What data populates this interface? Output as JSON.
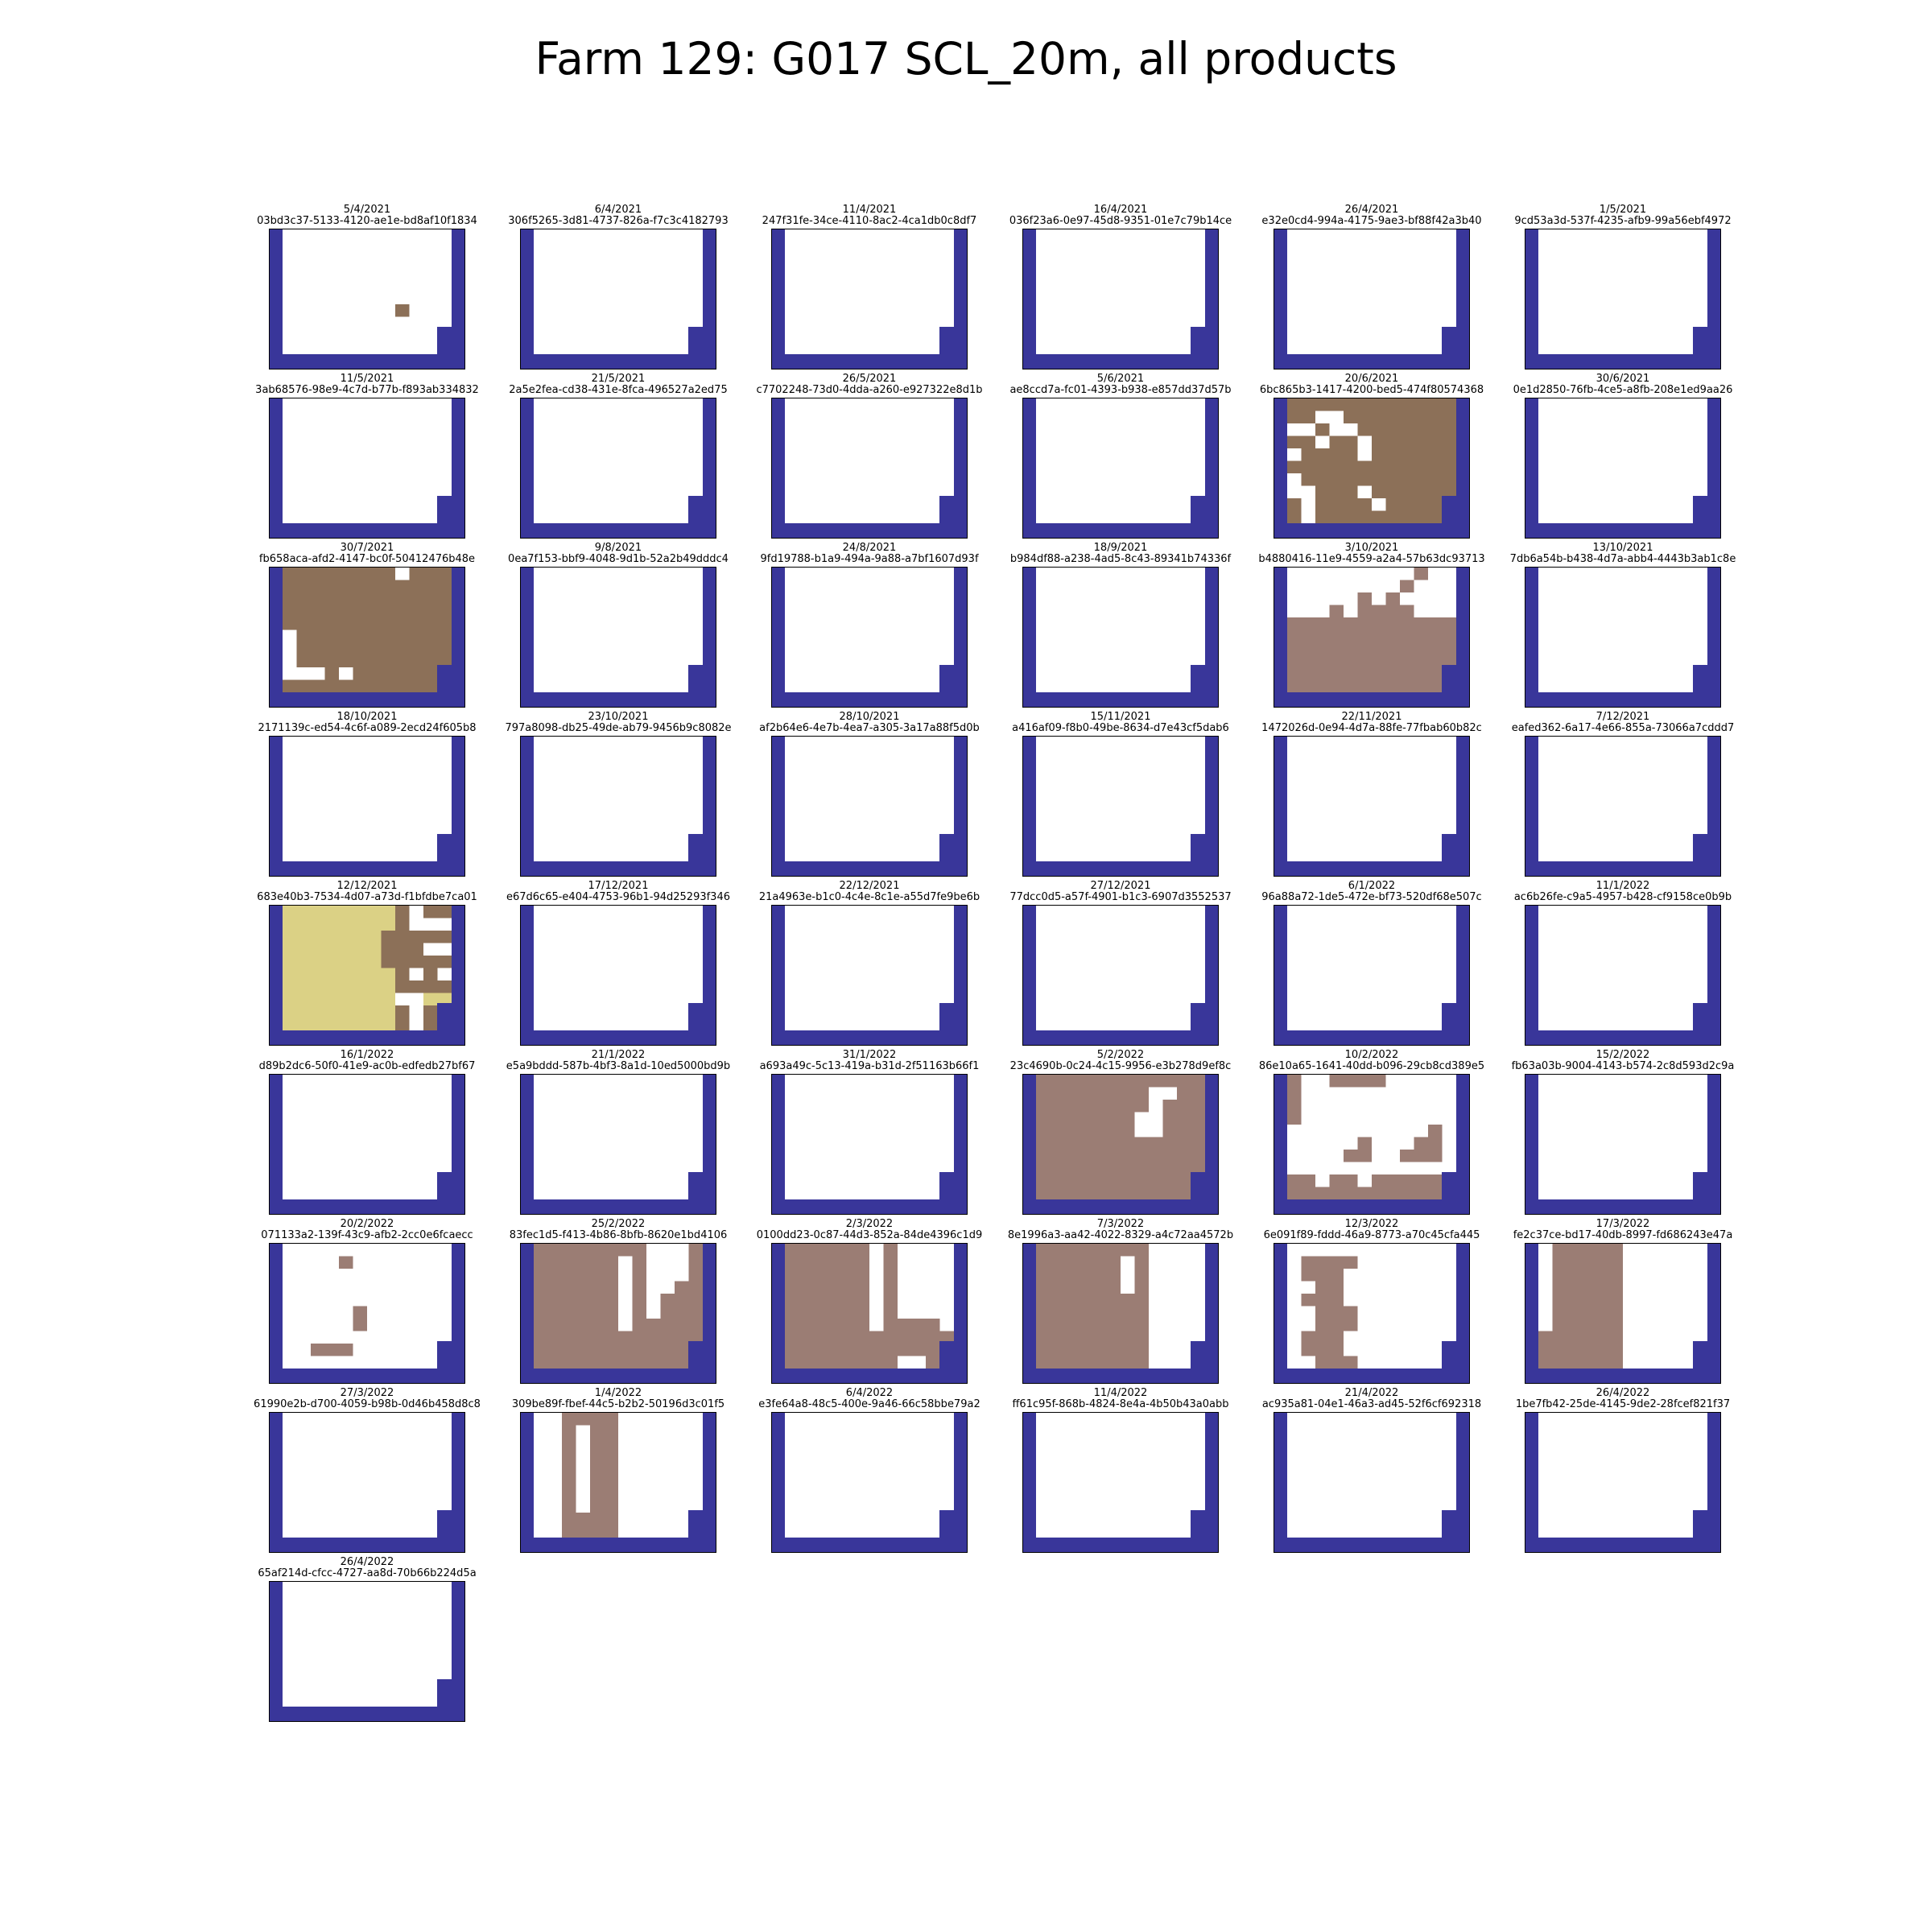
{
  "title": "Farm 129: G017 SCL_20m, all products",
  "colors": {
    "clear": "#ffffff",
    "nodata": "#39369a",
    "bare": "#8c7058",
    "cloud": "#9b7d74",
    "snow": "#dbd185"
  },
  "grid": {
    "cols": 13,
    "rows": 10
  },
  "panels": [
    {
      "date": "5/4/2021",
      "id": "03bd3c37-5133-4120-ae1e-bd8af10f1834",
      "cells": [
        {
          "c": "bare",
          "r": [
            [
              9,
              6,
              1,
              1
            ]
          ]
        }
      ]
    },
    {
      "date": "6/4/2021",
      "id": "306f5265-3d81-4737-826a-f7c3c4182793",
      "cells": []
    },
    {
      "date": "11/4/2021",
      "id": "247f31fe-34ce-4110-8ac2-4ca1db0c8df7",
      "cells": []
    },
    {
      "date": "16/4/2021",
      "id": "036f23a6-0e97-45d8-9351-01e7c79b14ce",
      "cells": []
    },
    {
      "date": "26/4/2021",
      "id": "e32e0cd4-994a-4175-9ae3-bf88f42a3b40",
      "cells": []
    },
    {
      "date": "1/5/2021",
      "id": "9cd53a3d-537f-4235-afb9-99a56ebf4972",
      "cells": []
    },
    {
      "date": "11/5/2021",
      "id": "3ab68576-98e9-4c7d-b77b-f893ab334832",
      "cells": []
    },
    {
      "date": "21/5/2021",
      "id": "2a5e2fea-cd38-431e-8fca-496527a2ed75",
      "cells": []
    },
    {
      "date": "26/5/2021",
      "id": "c7702248-73d0-4dda-a260-e927322e8d1b",
      "cells": []
    },
    {
      "date": "5/6/2021",
      "id": "ae8ccd7a-fc01-4393-b938-e857dd37d57b",
      "cells": []
    },
    {
      "date": "20/6/2021",
      "id": "6bc865b3-1417-4200-bed5-474f80574368",
      "cells": [
        {
          "c": "bare",
          "r": [
            [
              1,
              0,
              12,
              10
            ]
          ]
        },
        {
          "c": "clear",
          "r": [
            [
              3,
              1,
              2,
              1
            ],
            [
              1,
              2,
              2,
              1
            ],
            [
              4,
              2,
              2,
              1
            ],
            [
              3,
              3,
              1,
              1
            ],
            [
              6,
              3,
              1,
              2
            ],
            [
              1,
              4,
              1,
              1
            ],
            [
              1,
              6,
              1,
              2
            ],
            [
              6,
              7,
              1,
              1
            ],
            [
              2,
              7,
              1,
              1
            ],
            [
              7,
              8,
              1,
              1
            ],
            [
              2,
              8,
              1,
              2
            ]
          ]
        }
      ]
    },
    {
      "date": "30/6/2021",
      "id": "0e1d2850-76fb-4ce5-a8fb-208e1ed9aa26",
      "cells": []
    },
    {
      "date": "30/7/2021",
      "id": "fb658aca-afd2-4147-bc0f-50412476b48e",
      "cells": [
        {
          "c": "bare",
          "r": [
            [
              1,
              0,
              12,
              10
            ]
          ]
        },
        {
          "c": "clear",
          "r": [
            [
              9,
              0,
              1,
              1
            ],
            [
              1,
              5,
              1,
              4
            ],
            [
              2,
              8,
              2,
              1
            ],
            [
              5,
              8,
              1,
              1
            ]
          ]
        }
      ]
    },
    {
      "date": "9/8/2021",
      "id": "0ea7f153-bbf9-4048-9d1b-52a2b49dddc4",
      "cells": []
    },
    {
      "date": "24/8/2021",
      "id": "9fd19788-b1a9-494a-9a88-a7bf1607d93f",
      "cells": []
    },
    {
      "date": "18/9/2021",
      "id": "b984df88-a238-4ad5-8c43-89341b74336f",
      "cells": []
    },
    {
      "date": "3/10/2021",
      "id": "b4880416-11e9-4559-a2a4-57b63dc93713",
      "cells": [
        {
          "c": "cloud",
          "r": [
            [
              1,
              0,
              12,
              10
            ]
          ]
        },
        {
          "c": "clear",
          "r": [
            [
              1,
              0,
              9,
              1
            ],
            [
              11,
              0,
              2,
              1
            ],
            [
              1,
              1,
              8,
              1
            ],
            [
              10,
              1,
              3,
              1
            ],
            [
              1,
              2,
              5,
              1
            ],
            [
              7,
              2,
              1,
              1
            ],
            [
              9,
              2,
              4,
              1
            ],
            [
              1,
              3,
              3,
              1
            ],
            [
              5,
              3,
              1,
              1
            ],
            [
              10,
              3,
              3,
              1
            ]
          ]
        }
      ]
    },
    {
      "date": "13/10/2021",
      "id": "7db6a54b-b438-4d7a-abb4-4443b3ab1c8e",
      "cells": []
    },
    {
      "date": "18/10/2021",
      "id": "2171139c-ed54-4c6f-a089-2ecd24f605b8",
      "cells": []
    },
    {
      "date": "23/10/2021",
      "id": "797a8098-db25-49de-ab79-9456b9c8082e",
      "cells": []
    },
    {
      "date": "28/10/2021",
      "id": "af2b64e6-4e7b-4ea7-a305-3a17a88f5d0b",
      "cells": []
    },
    {
      "date": "15/11/2021",
      "id": "a416af09-f8b0-49be-8634-d7e43cf5dab6",
      "cells": []
    },
    {
      "date": "22/11/2021",
      "id": "1472026d-0e94-4d7a-88fe-77fbab60b82c",
      "cells": []
    },
    {
      "date": "7/12/2021",
      "id": "eafed362-6a17-4e66-855a-73066a7cddd7",
      "cells": []
    },
    {
      "date": "12/12/2021",
      "id": "683e40b3-7534-4d07-a73d-f1bfdbe7ca01",
      "cells": [
        {
          "c": "snow",
          "r": [
            [
              1,
              0,
              12,
              10
            ]
          ]
        },
        {
          "c": "bare",
          "r": [
            [
              9,
              0,
              4,
              1
            ],
            [
              8,
              2,
              5,
              1
            ],
            [
              8,
              3,
              5,
              1
            ],
            [
              8,
              4,
              5,
              1
            ],
            [
              9,
              5,
              4,
              1
            ],
            [
              9,
              6,
              4,
              1
            ],
            [
              9,
              8,
              4,
              1
            ],
            [
              9,
              9,
              4,
              1
            ]
          ]
        },
        {
          "c": "clear",
          "r": [
            [
              10,
              0,
              1,
              1
            ],
            [
              10,
              1,
              3,
              1
            ],
            [
              11,
              3,
              2,
              1
            ],
            [
              10,
              5,
              1,
              1
            ],
            [
              12,
              5,
              1,
              1
            ],
            [
              10,
              7,
              1,
              3
            ],
            [
              9,
              7,
              1,
              1
            ]
          ]
        },
        {
          "c": "bare",
          "r": [
            [
              9,
              1,
              1,
              1
            ],
            [
              11,
              6,
              1,
              1
            ]
          ]
        }
      ]
    },
    {
      "date": "17/12/2021",
      "id": "e67d6c65-e404-4753-96b1-94d25293f346",
      "cells": []
    },
    {
      "date": "22/12/2021",
      "id": "21a4963e-b1c0-4c4e-8c1e-a55d7fe9be6b",
      "cells": []
    },
    {
      "date": "27/12/2021",
      "id": "77dcc0d5-a57f-4901-b1c3-6907d3552537",
      "cells": []
    },
    {
      "date": "6/1/2022",
      "id": "96a88a72-1de5-472e-bf73-520df68e507c",
      "cells": []
    },
    {
      "date": "11/1/2022",
      "id": "ac6b26fe-c9a5-4957-b428-cf9158ce0b9b",
      "cells": []
    },
    {
      "date": "16/1/2022",
      "id": "d89b2dc6-50f0-41e9-ac0b-edfedb27bf67",
      "cells": []
    },
    {
      "date": "21/1/2022",
      "id": "e5a9bddd-587b-4bf3-8a1d-10ed5000bd9b",
      "cells": []
    },
    {
      "date": "31/1/2022",
      "id": "a693a49c-5c13-419a-b31d-2f51163b66f1",
      "cells": []
    },
    {
      "date": "5/2/2022",
      "id": "23c4690b-0c24-4c15-9956-e3b278d9ef8c",
      "cells": [
        {
          "c": "cloud",
          "r": [
            [
              1,
              0,
              12,
              10
            ]
          ]
        },
        {
          "c": "clear",
          "r": [
            [
              9,
              1,
              2,
              1
            ],
            [
              9,
              2,
              1,
              1
            ],
            [
              8,
              3,
              2,
              1
            ],
            [
              8,
              4,
              2,
              1
            ]
          ]
        }
      ]
    },
    {
      "date": "10/2/2022",
      "id": "86e10a65-1641-40dd-b096-29cb8cd389e5",
      "cells": [
        {
          "c": "cloud",
          "r": [
            [
              1,
              0,
              1,
              4
            ],
            [
              4,
              0,
              4,
              1
            ],
            [
              11,
              4,
              1,
              1
            ],
            [
              10,
              5,
              2,
              1
            ],
            [
              6,
              5,
              1,
              1
            ],
            [
              9,
              6,
              3,
              1
            ],
            [
              5,
              6,
              2,
              1
            ],
            [
              1,
              8,
              2,
              1
            ],
            [
              4,
              8,
              2,
              1
            ],
            [
              7,
              8,
              5,
              1
            ],
            [
              1,
              9,
              6,
              1
            ],
            [
              7,
              9,
              5,
              1
            ]
          ]
        }
      ]
    },
    {
      "date": "15/2/2022",
      "id": "fb63a03b-9004-4143-b574-2c8d593d2c9a",
      "cells": []
    },
    {
      "date": "20/2/2022",
      "id": "071133a2-139f-43c9-afb2-2cc0e6fcaecc",
      "cells": [
        {
          "c": "cloud",
          "r": [
            [
              5,
              1,
              1,
              1
            ],
            [
              6,
              5,
              1,
              2
            ],
            [
              3,
              8,
              3,
              1
            ]
          ]
        }
      ]
    },
    {
      "date": "25/2/2022",
      "id": "83fec1d5-f413-4b86-8bfb-8620e1bd4106",
      "cells": [
        {
          "c": "cloud",
          "r": [
            [
              1,
              0,
              12,
              10
            ]
          ]
        },
        {
          "c": "clear",
          "r": [
            [
              7,
              1,
              1,
              6
            ],
            [
              9,
              0,
              1,
              6
            ],
            [
              10,
              0,
              2,
              3
            ],
            [
              10,
              2,
              1,
              2
            ]
          ]
        }
      ]
    },
    {
      "date": "2/3/2022",
      "id": "0100dd23-0c87-44d3-852a-84de4396c1d9",
      "cells": [
        {
          "c": "cloud",
          "r": [
            [
              1,
              0,
              12,
              10
            ]
          ]
        },
        {
          "c": "clear",
          "r": [
            [
              7,
              0,
              1,
              7
            ],
            [
              9,
              0,
              4,
              6
            ],
            [
              12,
              6,
              1,
              1
            ],
            [
              9,
              9,
              2,
              1
            ]
          ]
        }
      ]
    },
    {
      "date": "7/3/2022",
      "id": "8e1996a3-aa42-4022-8329-a4c72aa4572b",
      "cells": [
        {
          "c": "cloud",
          "r": [
            [
              1,
              0,
              8,
              10
            ]
          ]
        },
        {
          "c": "clear",
          "r": [
            [
              7,
              1,
              1,
              3
            ]
          ]
        }
      ]
    },
    {
      "date": "12/3/2022",
      "id": "6e091f89-fddd-46a9-8773-a70c45cfa445",
      "cells": [
        {
          "c": "cloud",
          "r": [
            [
              2,
              1,
              4,
              1
            ],
            [
              2,
              2,
              3,
              1
            ],
            [
              3,
              3,
              2,
              1
            ],
            [
              2,
              4,
              3,
              1
            ],
            [
              3,
              5,
              3,
              1
            ],
            [
              3,
              6,
              3,
              1
            ],
            [
              2,
              7,
              3,
              1
            ],
            [
              2,
              8,
              3,
              1
            ],
            [
              3,
              9,
              3,
              1
            ]
          ]
        }
      ]
    },
    {
      "date": "17/3/2022",
      "id": "fe2c37ce-bd17-40db-8997-fd686243e47a",
      "cells": [
        {
          "c": "cloud",
          "r": [
            [
              2,
              0,
              5,
              10
            ],
            [
              1,
              7,
              1,
              3
            ]
          ]
        }
      ]
    },
    {
      "date": "27/3/2022",
      "id": "61990e2b-d700-4059-b98b-0d46b458d8c8",
      "cells": []
    },
    {
      "date": "1/4/2022",
      "id": "309be89f-fbef-44c5-b2b2-50196d3c01f5",
      "cells": [
        {
          "c": "cloud",
          "r": [
            [
              3,
              0,
              1,
              10
            ],
            [
              5,
              0,
              1,
              5
            ],
            [
              4,
              8,
              1,
              2
            ],
            [
              5,
              5,
              2,
              5
            ],
            [
              6,
              0,
              1,
              5
            ]
          ]
        },
        {
          "c": "cloud",
          "r": [
            [
              4,
              0,
              1,
              1
            ]
          ]
        }
      ]
    },
    {
      "date": "6/4/2022",
      "id": "e3fe64a8-48c5-400e-9a46-66c58bbe79a2",
      "cells": []
    },
    {
      "date": "11/4/2022",
      "id": "ff61c95f-868b-4824-8e4a-4b50b43a0abb",
      "cells": []
    },
    {
      "date": "21/4/2022",
      "id": "ac935a81-04e1-46a3-ad45-52f6cf692318",
      "cells": []
    },
    {
      "date": "26/4/2022",
      "id": "1be7fb42-25de-4145-9de2-28fcef821f37",
      "cells": []
    },
    {
      "date": "26/4/2022",
      "id": "65af214d-cfcc-4727-aa8d-70b66b224d5a",
      "cells": []
    }
  ]
}
